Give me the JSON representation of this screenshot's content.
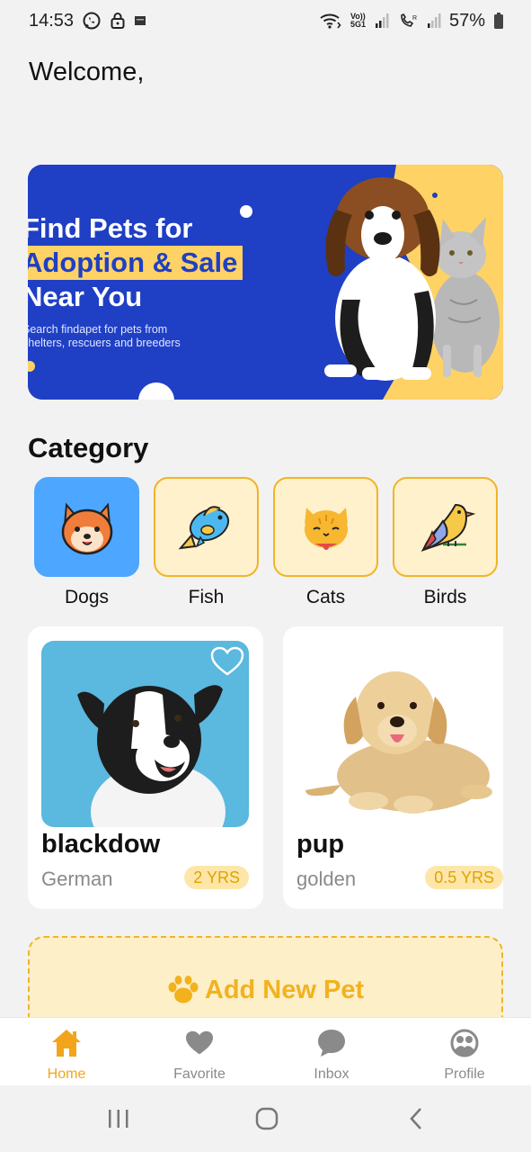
{
  "status_bar": {
    "time": "14:53",
    "battery": "57%",
    "icons_left": [
      "whatsapp-icon",
      "lock-icon",
      "notification-icon"
    ],
    "icons_right": [
      "wifi-icon",
      "volte-icon",
      "signal-icon",
      "call-icon",
      "signal-icon",
      "battery-icon"
    ],
    "volte_text": "Vo)) 5G1"
  },
  "greeting": "Welcome,",
  "banner": {
    "title_line1": "Find Pets for",
    "title_line2": "Adoption & Sale",
    "title_line3": "Near You",
    "subtitle_line1": "Search findapet for pets from",
    "subtitle_line2": "shelters, rescuers and breeders",
    "colors": {
      "background": "#1f3fc4",
      "accent": "#ffd266"
    }
  },
  "category_section": {
    "title": "Category",
    "items": [
      {
        "label": "Dogs",
        "icon": "shiba-dog-icon",
        "active": true
      },
      {
        "label": "Fish",
        "icon": "fish-icon",
        "active": false
      },
      {
        "label": "Cats",
        "icon": "cat-icon",
        "active": false
      },
      {
        "label": "Birds",
        "icon": "bird-icon",
        "active": false
      }
    ]
  },
  "pets": [
    {
      "name": "blackdow",
      "breed": "German",
      "age": "2 YRS",
      "image": "border-collie-photo",
      "favorite": false
    },
    {
      "name": "pup",
      "breed": "golden",
      "age": "0.5 YRS",
      "image": "golden-retriever-puppy-photo",
      "favorite": false
    }
  ],
  "add_pet": {
    "label": "Add New Pet",
    "icon": "paw-icon"
  },
  "bottom_nav": {
    "items": [
      {
        "label": "Home",
        "icon": "home-icon",
        "active": true
      },
      {
        "label": "Favorite",
        "icon": "heart-icon",
        "active": false
      },
      {
        "label": "Inbox",
        "icon": "chat-bubble-icon",
        "active": false
      },
      {
        "label": "Profile",
        "icon": "profile-icon",
        "active": false
      }
    ],
    "colors": {
      "active": "#f2a51a",
      "inactive": "#8a8a8a"
    }
  },
  "system_nav": [
    "recents-icon",
    "home-circle-icon",
    "back-icon"
  ]
}
